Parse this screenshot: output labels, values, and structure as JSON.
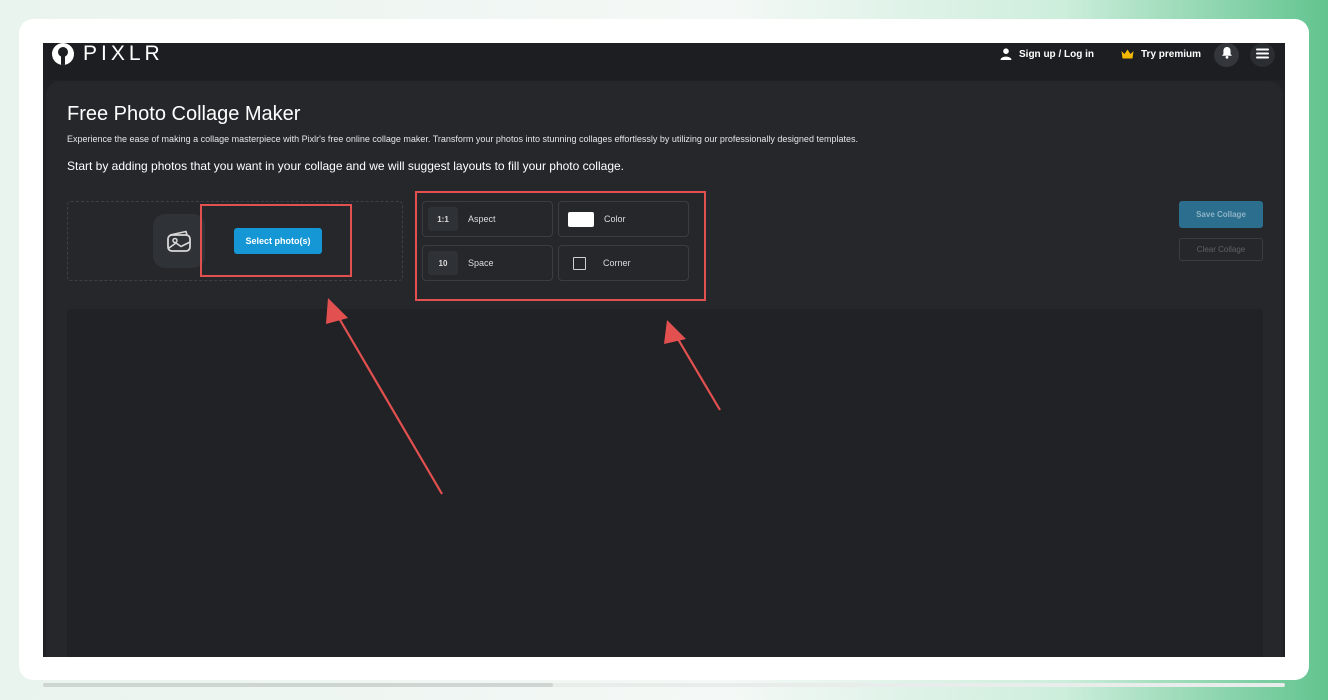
{
  "app": {
    "brand": "PIXLR"
  },
  "header": {
    "signup_label": "Sign up / Log in",
    "premium_label": "Try premium"
  },
  "page": {
    "title": "Free Photo Collage Maker",
    "description": "Experience the ease of making a collage masterpiece with Pixlr's free online collage maker. Transform your photos into stunning collages effortlessly by utilizing our professionally designed templates.",
    "lead": "Start by adding photos that you want in your collage and we will suggest layouts to fill your photo collage."
  },
  "upload": {
    "select_label": "Select photo(s)"
  },
  "options": {
    "aspect": {
      "value": "1:1",
      "label": "Aspect"
    },
    "color": {
      "label": "Color",
      "swatch": "#ffffff"
    },
    "space": {
      "value": "10",
      "label": "Space"
    },
    "corner": {
      "label": "Corner"
    }
  },
  "actions": {
    "save_label": "Save Collage",
    "clear_label": "Clear Collage"
  },
  "colors": {
    "accent": "#1597d6",
    "annotation": "#e35050",
    "premium_crown": "#f5b800"
  },
  "icons": [
    "pixlr-logo-icon",
    "user-icon",
    "crown-icon",
    "bell-icon",
    "hamburger-menu-icon",
    "image-upload-icon",
    "arrow-icon"
  ]
}
